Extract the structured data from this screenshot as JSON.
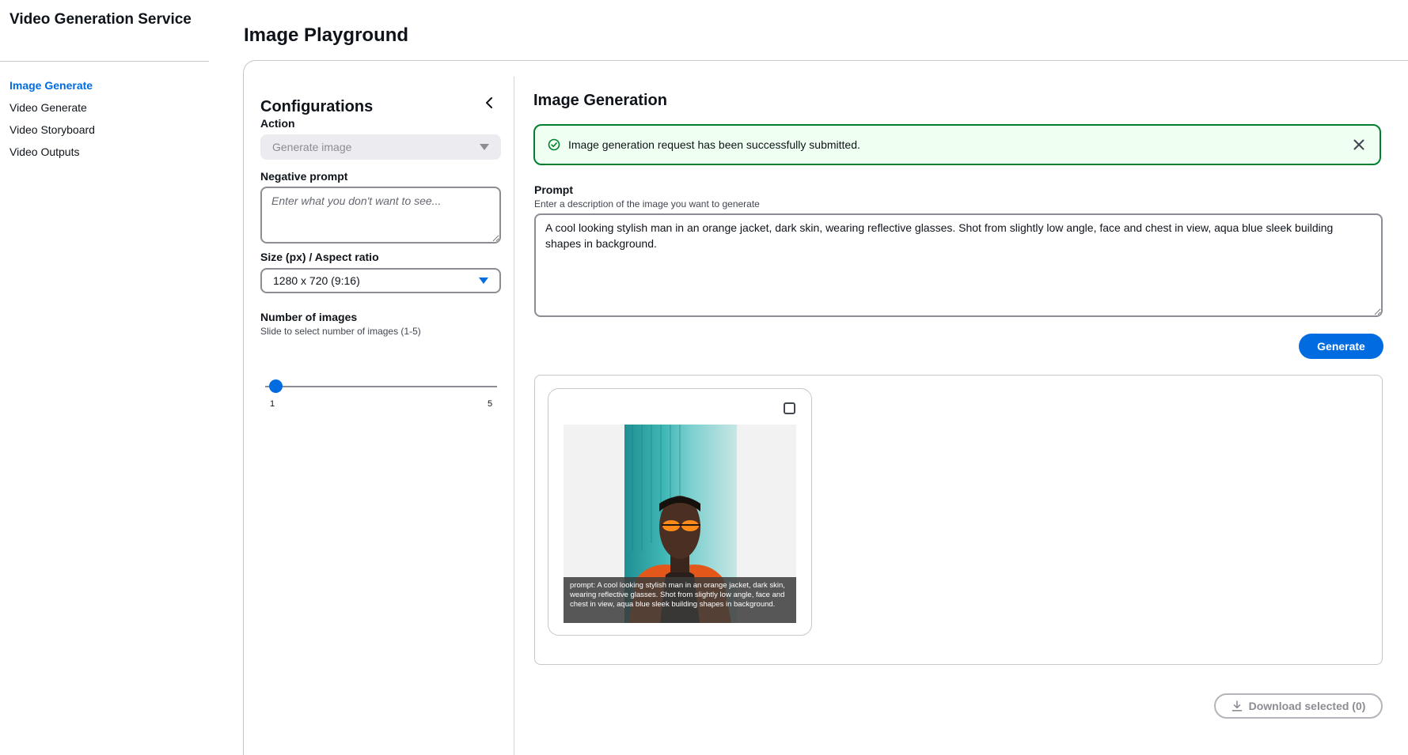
{
  "app": {
    "title": "Video Generation Service"
  },
  "sidebar": {
    "items": [
      {
        "label": "Image Generate",
        "active": true
      },
      {
        "label": "Video Generate",
        "active": false
      },
      {
        "label": "Video Storyboard",
        "active": false
      },
      {
        "label": "Video Outputs",
        "active": false
      }
    ]
  },
  "header": {
    "title": "Image Playground"
  },
  "config": {
    "title": "Configurations",
    "action": {
      "label": "Action",
      "value": "Generate image"
    },
    "negative_prompt": {
      "label": "Negative prompt",
      "placeholder": "Enter what you don't want to see...",
      "value": ""
    },
    "size": {
      "label": "Size (px) / Aspect ratio",
      "value": "1280 x 720 (9:16)"
    },
    "num_images": {
      "label": "Number of images",
      "description": "Slide to select number of images (1-5)",
      "min": "1",
      "max": "5",
      "value": 1
    }
  },
  "main": {
    "title": "Image Generation",
    "flash": {
      "message": "Image generation request has been successfully submitted.",
      "type": "success"
    },
    "prompt": {
      "label": "Prompt",
      "description": "Enter a description of the image you want to generate",
      "value": "A cool looking stylish man in an orange jacket, dark skin, wearing reflective glasses. Shot from slightly low angle, face and chest in view, aqua blue sleek building shapes in background."
    },
    "generate_label": "Generate",
    "results": [
      {
        "caption": "prompt: A cool looking stylish man in an orange jacket, dark skin, wearing reflective glasses. Shot from slightly low angle, face and chest in view, aqua blue sleek building shapes in background.",
        "selected": false
      }
    ],
    "download_label": "Download selected (0)"
  },
  "colors": {
    "accent": "#006ce0",
    "success": "#00802f",
    "success_bg": "#effff1"
  }
}
